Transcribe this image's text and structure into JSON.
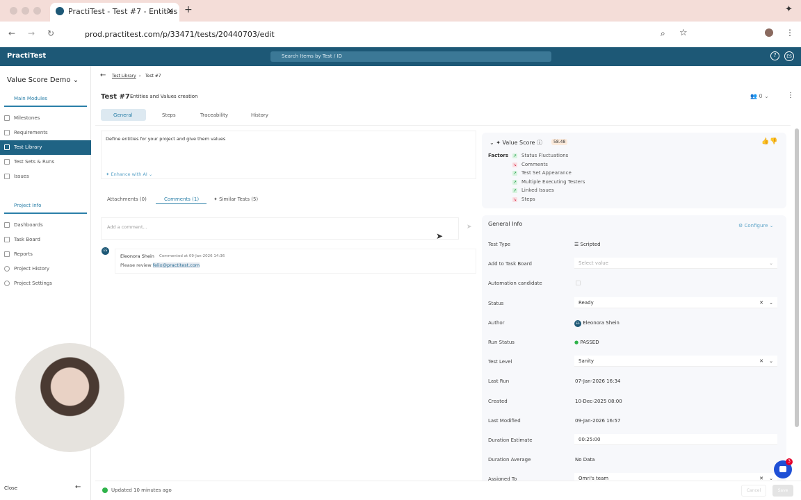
{
  "browser": {
    "tab_title": "PractiTest - Test #7 - Entities",
    "url": "prod.practitest.com/p/33471/tests/20440703/edit"
  },
  "header": {
    "logo": "PractiTest",
    "search_placeholder": "Search Items by Test / ID",
    "avatar": "ES"
  },
  "sidebar": {
    "project": "Value Score Demo",
    "main_modules": "Main Modules",
    "items": [
      {
        "label": "Milestones"
      },
      {
        "label": "Requirements"
      },
      {
        "label": "Test Library"
      },
      {
        "label": "Test Sets & Runs"
      },
      {
        "label": "Issues"
      }
    ],
    "project_info": "Project Info",
    "info_items": [
      {
        "label": "Dashboards"
      },
      {
        "label": "Task Board"
      },
      {
        "label": "Reports"
      },
      {
        "label": "Project History"
      },
      {
        "label": "Project Settings"
      }
    ],
    "close": "Close"
  },
  "breadcrumb": {
    "parent": "Test Library",
    "current": "Test #7"
  },
  "test": {
    "id": "Test #7",
    "name": "Entities and Values creation",
    "watchers": "0"
  },
  "tabs": [
    "General",
    "Steps",
    "Traceability",
    "History"
  ],
  "description": "Define entities for your project and give them values",
  "enhance": "Enhance with AI",
  "subtabs": [
    "Attachments (0)",
    "Comments (1)",
    "Similar Tests (5)"
  ],
  "comment": {
    "placeholder": "Add a comment...",
    "avatar": "ES",
    "author": "Eleonora Shein",
    "meta": "Commented at 09-Jan-2026 14:36",
    "text": "Please review",
    "mention": "felix@practitest.com"
  },
  "value_score": {
    "title": "Value Score",
    "score": "58.48",
    "factors_label": "Factors",
    "factors": [
      {
        "label": "Status Fluctuations",
        "dir": "up"
      },
      {
        "label": "Comments",
        "dir": "down"
      },
      {
        "label": "Test Set Appearance",
        "dir": "up"
      },
      {
        "label": "Multiple Executing Testers",
        "dir": "up"
      },
      {
        "label": "Linked Issues",
        "dir": "up"
      },
      {
        "label": "Steps",
        "dir": "down"
      }
    ]
  },
  "general_info": {
    "title": "General Info",
    "configure": "Configure",
    "fields": [
      {
        "label": "Test Type",
        "value": "Scripted"
      },
      {
        "label": "Add to Task Board",
        "value": "Select value"
      },
      {
        "label": "Automation candidate",
        "value": ""
      },
      {
        "label": "Status",
        "value": "Ready"
      },
      {
        "label": "Author",
        "value": "Eleonora Shein"
      },
      {
        "label": "Run Status",
        "value": "PASSED"
      },
      {
        "label": "Test Level",
        "value": "Sanity"
      },
      {
        "label": "Last Run",
        "value": "07-Jan-2026 16:34"
      },
      {
        "label": "Created",
        "value": "10-Dec-2025 08:00"
      },
      {
        "label": "Last Modified",
        "value": "09-Jan-2026 16:57"
      },
      {
        "label": "Duration Estimate",
        "value": "00:25:00"
      },
      {
        "label": "Duration Average",
        "value": "No Data"
      },
      {
        "label": "Assigned To",
        "value": "Omri's team"
      }
    ]
  },
  "footer": {
    "status": "Updated 10 minutes ago",
    "cancel": "Cancel",
    "save": "Save",
    "chat_badge": "3"
  },
  "colors": {
    "brand": "#1d5876",
    "accent": "#2a7fa8",
    "passed": "#2fb34a"
  }
}
